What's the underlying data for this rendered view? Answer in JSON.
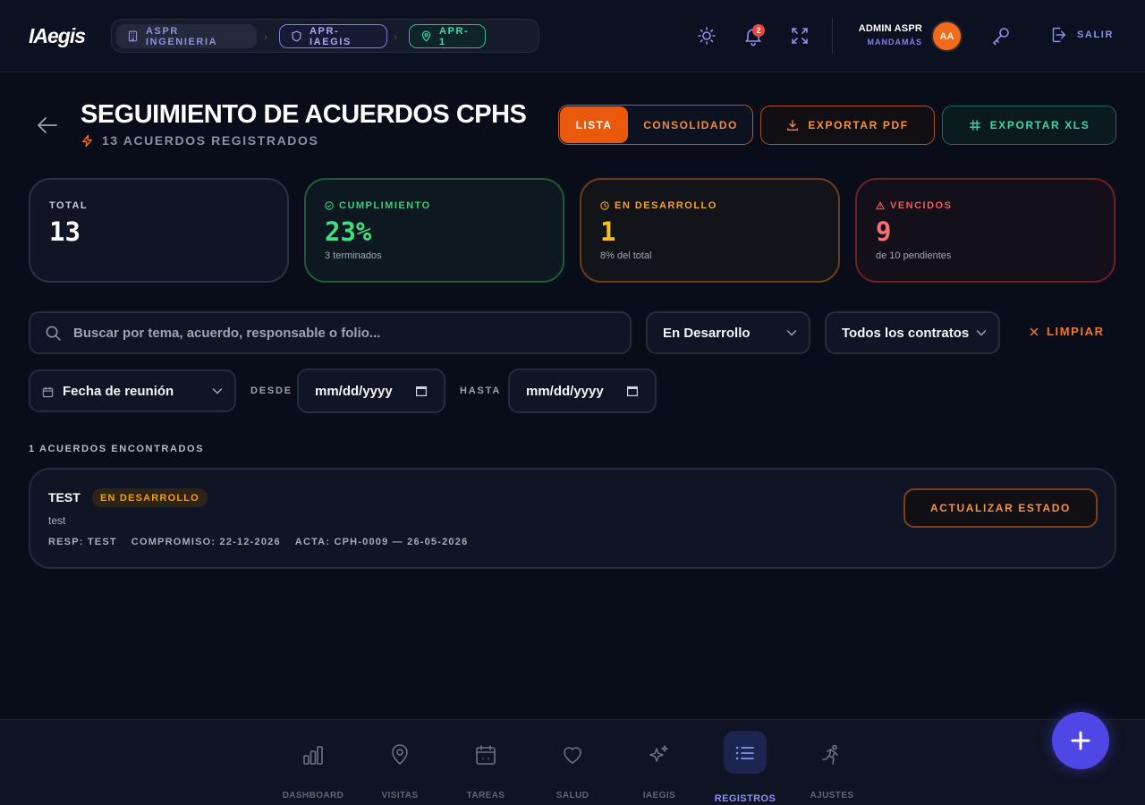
{
  "app": {
    "logo": "IAegis"
  },
  "breadcrumb": [
    {
      "label": "ASPR INGENIERIA",
      "icon": "building-icon"
    },
    {
      "label": "APR-IAEGIS",
      "icon": "shield-icon"
    },
    {
      "label": "APR-1",
      "icon": "map-pin-icon"
    }
  ],
  "header": {
    "notifications_count": "2",
    "user_name": "ADMIN ASPR",
    "user_role": "MANDAMÁS",
    "avatar_initials": "AA",
    "logout_label": "SALIR",
    "icons": [
      "sun-icon",
      "bell-icon",
      "fullscreen-icon",
      "key-icon",
      "logout-icon"
    ]
  },
  "page": {
    "title": "SEGUIMIENTO DE ACUERDOS CPHS",
    "subtitle": "13 ACUERDOS REGISTRADOS"
  },
  "view_toggle": {
    "active": "LISTA",
    "inactive": "CONSOLIDADO"
  },
  "actions": {
    "export_pdf": "EXPORTAR PDF",
    "export_xls": "EXPORTAR XLS"
  },
  "stats": [
    {
      "label": "TOTAL",
      "value": "13",
      "sub": ""
    },
    {
      "label": "CUMPLIMIENTO",
      "value": "23%",
      "sub": "3 terminados"
    },
    {
      "label": "EN DESARROLLO",
      "value": "1",
      "sub": "8% del total"
    },
    {
      "label": "VENCIDOS",
      "value": "9",
      "sub": "de 10 pendientes"
    }
  ],
  "filters": {
    "search_placeholder": "Buscar por tema, acuerdo, responsable o folio...",
    "search_value": "",
    "status_select": "En Desarrollo",
    "contract_select": "Todos los contratos",
    "clear_label": "LIMPIAR",
    "date_field_select": "Fecha de reunión",
    "from_label": "DESDE",
    "from_value": "mm/dd/yyyy",
    "to_label": "HASTA",
    "to_value": "mm/dd/yyyy"
  },
  "results": {
    "count_label": "1 ACUERDOS ENCONTRADOS",
    "items": [
      {
        "title": "TEST",
        "status": "EN DESARROLLO",
        "description": "test",
        "responsable": "RESP: TEST",
        "compromiso": "COMPROMISO: 22-12-2026",
        "acta": "ACTA: CPH-0009 — 26-05-2026",
        "action_label": "ACTUALIZAR ESTADO"
      }
    ]
  },
  "bottom_nav": [
    {
      "label": "DASHBOARD",
      "icon": "bar-chart-icon"
    },
    {
      "label": "VISITAS",
      "icon": "map-pin-icon"
    },
    {
      "label": "TAREAS",
      "icon": "calendar-icon"
    },
    {
      "label": "SALUD",
      "icon": "heart-icon"
    },
    {
      "label": "IAEGIS",
      "icon": "sparkles-icon"
    },
    {
      "label": "REGISTROS",
      "icon": "list-icon",
      "active": true
    },
    {
      "label": "AJUSTES",
      "icon": "runner-icon"
    }
  ],
  "colors": {
    "background": "#080d19",
    "accent_orange": "#ea580c",
    "accent_indigo": "#4f46e5",
    "success": "#3ee07f",
    "warning": "#fbbf24",
    "danger": "#f87171"
  }
}
